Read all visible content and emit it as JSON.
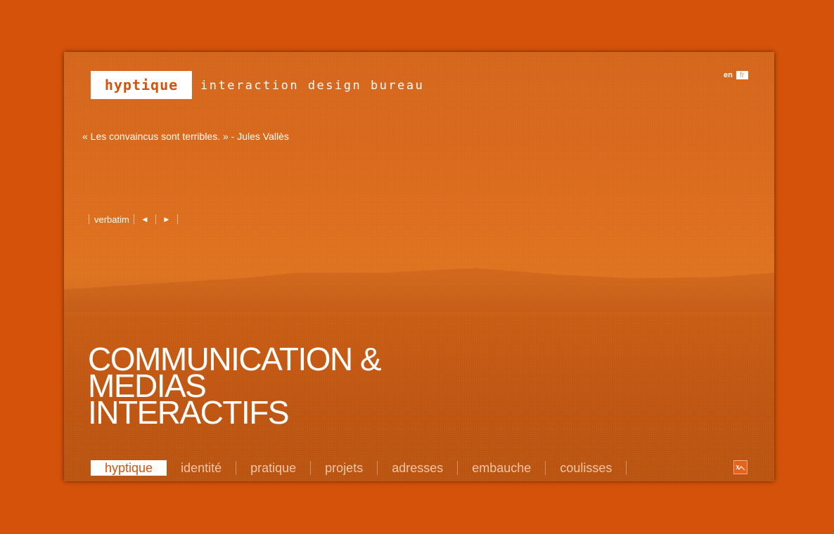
{
  "header": {
    "logo": "hyptique",
    "tagline": "interaction design bureau"
  },
  "lang": {
    "en": "en",
    "fr": "fr"
  },
  "quote": "«  Les convaincus sont terribles. » - Jules Vallès",
  "verbatim": {
    "label": "verbatim",
    "prev_icon": "arrow-left-icon",
    "next_icon": "arrow-right-icon"
  },
  "headline": {
    "line1": "COMMUNICATION &",
    "line2": "MEDIAS",
    "line3": "INTERACTIFS"
  },
  "nav": {
    "items": [
      {
        "label": "hyptique"
      },
      {
        "label": "identité"
      },
      {
        "label": "pratique"
      },
      {
        "label": "projets"
      },
      {
        "label": "adresses"
      },
      {
        "label": "embauche"
      },
      {
        "label": "coulisses"
      }
    ],
    "active_index": 0
  },
  "corner_icon": "chart-zigzag-icon",
  "colors": {
    "background": "#d4520a",
    "accent": "#ffffff"
  }
}
